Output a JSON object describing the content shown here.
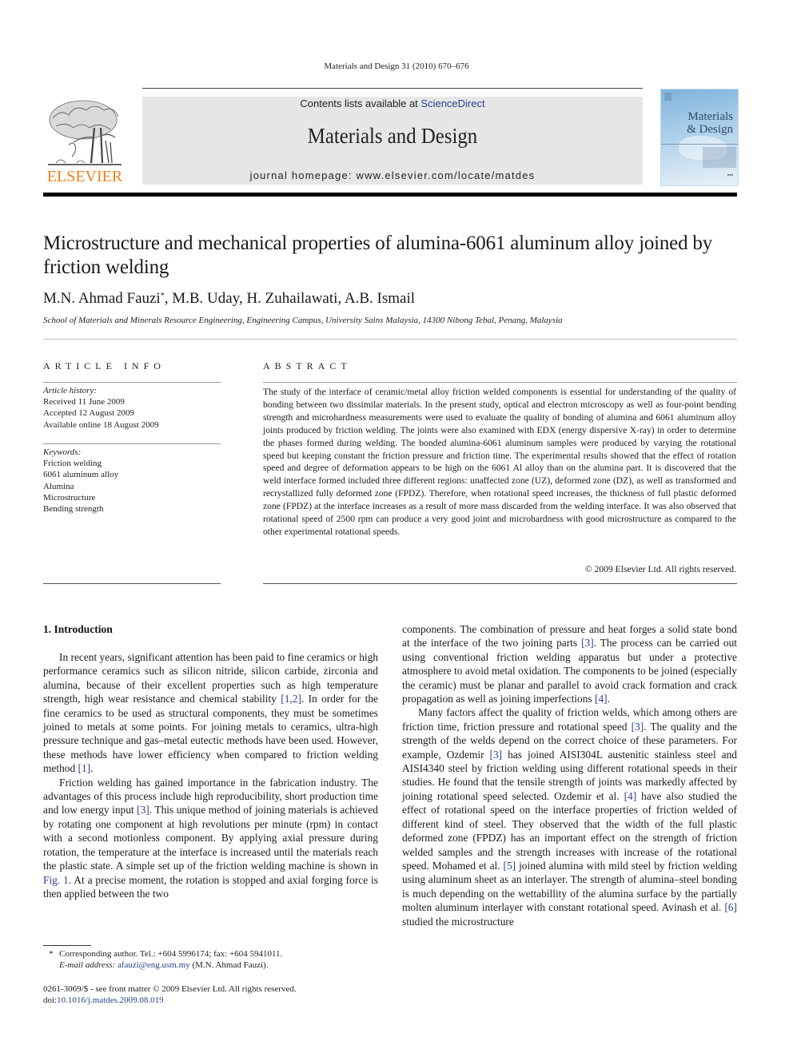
{
  "running_head": "Materials and Design 31 (2010) 670–676",
  "masthead": {
    "publisher_logo_text": "ELSEVIER",
    "contents_prefix": "Contents lists available at ",
    "contents_link": "ScienceDirect",
    "journal_title": "Materials and Design",
    "homepage": "journal homepage: www.elsevier.com/locate/matdes",
    "cover_title_line1": "Materials",
    "cover_title_line2": "& Design",
    "brand_color": "#f07f1a",
    "link_color": "#2a3f8f"
  },
  "article": {
    "title": "Microstructure and mechanical properties of alumina-6061 aluminum alloy joined by friction welding",
    "authors_first": "M.N. Ahmad Fauzi",
    "authors_first_mark": "*",
    "authors_rest": ", M.B. Uday, H. Zuhailawati, A.B. Ismail",
    "affiliation": "School of Materials and Minerals Resource Engineering, Engineering Campus, University Sains Malaysia, 14300 Nibong Tebal, Penang, Malaysia"
  },
  "article_info": {
    "heading": "ARTICLE INFO",
    "history_label": "Article history:",
    "history": [
      "Received 11 June 2009",
      "Accepted 12 August 2009",
      "Available online 18 August 2009"
    ],
    "keywords_label": "Keywords:",
    "keywords": [
      "Friction welding",
      "6061 aluminum alloy",
      "Alumina",
      "Microstructure",
      "Bending strength"
    ]
  },
  "abstract": {
    "heading": "ABSTRACT",
    "text": "The study of the interface of ceramic/metal alloy friction welded components is essential for understanding of the quality of bonding between two dissimilar materials. In the present study, optical and electron microscopy as well as four-point bending strength and microhardness measurements were used to evaluate the quality of bonding of alumina and 6061 aluminum alloy joints produced by friction welding. The joints were also examined with EDX (energy dispersive X-ray) in order to determine the phases formed during welding. The bonded alumina-6061 aluminum samples were produced by varying the rotational speed but keeping constant the friction pressure and friction time. The experimental results showed that the effect of rotation speed and degree of deformation appears to be high on the 6061 Al alloy than on the alumina part. It is discovered that the weld interface formed included three different regions: unaffected zone (UZ), deformed zone (DZ), as well as transformed and recrystallized fully deformed zone (FPDZ). Therefore, when rotational speed increases, the thickness of full plastic deformed zone (FPDZ) at the interface increases as a result of more mass discarded from the welding interface. It was also observed that rotational speed of 2500 rpm can produce a very good joint and microhardness with good microstructure as compared to the other experimental rotational speeds.",
    "copyright": "© 2009 Elsevier Ltd. All rights reserved."
  },
  "body": {
    "section_heading": "1. Introduction",
    "left_p1": {
      "a": "In recent years, significant attention has been paid to fine ceramics or high performance ceramics such as silicon nitride, silicon carbide, zirconia and alumina, because of their excellent properties such as high temperature strength, high wear resistance and chemical stability ",
      "ref1": "[1,2]",
      "b": ". In order for the fine ceramics to be used as structural components, they must be sometimes joined to metals at some points. For joining metals to ceramics, ultra-high pressure technique and gas–metal eutectic methods have been used. However, these methods have lower efficiency when compared to friction welding method ",
      "ref2": "[1]",
      "c": "."
    },
    "left_p2": {
      "a": "Friction welding has gained importance in the fabrication industry. The advantages of this process include high reproducibility, short production time and low energy input ",
      "ref1": "[3]",
      "b": ". This unique method of joining materials is achieved by rotating one component at high revolutions per minute (rpm) in contact with a second motionless component. By applying axial pressure during rotation, the temperature at the interface is increased until the materials reach the plastic state. A simple set up of the friction welding machine is shown in ",
      "fig": "Fig. 1",
      "c": ". At a precise moment, the rotation is stopped and axial forging force is then applied between the two"
    },
    "right_p1": {
      "a": "components. The combination of pressure and heat forges a solid state bond at the interface of the two joining parts ",
      "ref1": "[3]",
      "b": ". The process can be carried out using conventional friction welding apparatus but under a protective atmosphere to avoid metal oxidation. The components to be joined (especially the ceramic) must be planar and parallel to avoid crack formation and crack propagation as well as joining imperfections ",
      "ref2": "[4]",
      "c": "."
    },
    "right_p2": {
      "a": "Many factors affect the quality of friction welds, which among others are friction time, friction pressure and rotational speed ",
      "ref1": "[3]",
      "b": ". The quality and the strength of the welds depend on the correct choice of these parameters. For example, Ozdemir ",
      "ref2": "[3]",
      "c": " has joined AISI304L austenitic stainless steel and AISI4340 steel by friction welding using different rotational speeds in their studies. He found that the tensile strength of joints was markedly affected by joining rotational speed selected. Ozdemir et al. ",
      "ref3": "[4]",
      "d": " have also studied the effect of rotational speed on the interface properties of friction welded of different kind of steel. They observed that the width of the full plastic deformed zone (FPDZ) has an important effect on the strength of friction welded samples and the strength increases with increase of the rotational speed. Mohamed et al. ",
      "ref4": "[5]",
      "e": " joined alumina with mild steel by friction welding using aluminum sheet as an interlayer. The strength of alumina–steel bonding is much depending on the wettabillity of the alumina surface by the partially molten aluminum interlayer with constant rotational speed. Avinash et al. ",
      "ref5": "[6]",
      "f": " studied the microstructure"
    }
  },
  "footnotes": {
    "star": "*",
    "corresponding": "Corresponding author. Tel.: +604 5996174; fax: +604 5941011.",
    "email_label": "E-mail address: ",
    "email": "afauzi@eng.usm.my",
    "email_suffix": " (M.N. Ahmad Fauzi).",
    "front_matter": "0261-3069/$ - see front matter © 2009 Elsevier Ltd. All rights reserved.",
    "doi_prefix": "doi:",
    "doi": "10.1016/j.matdes.2009.08.019"
  }
}
